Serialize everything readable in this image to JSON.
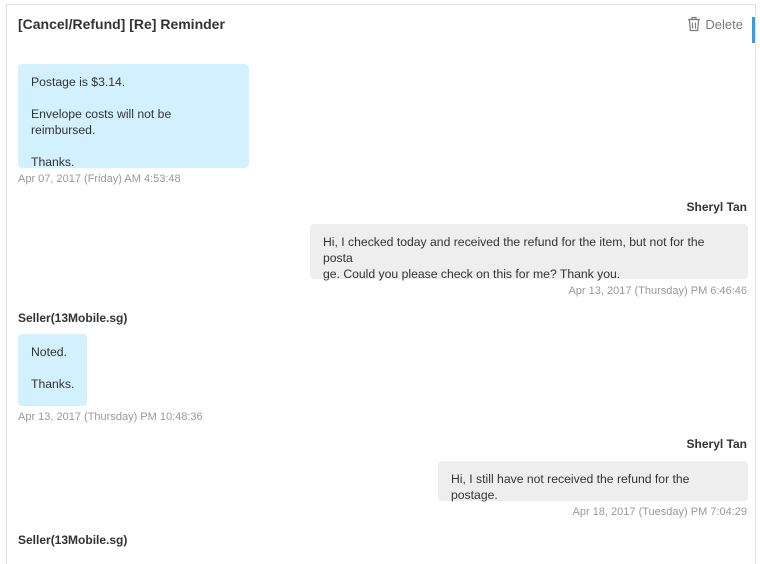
{
  "header": {
    "title": "[Cancel/Refund] [Re] Reminder",
    "delete_label": "Delete",
    "accent_color": "#2ea3e3"
  },
  "messages": [
    {
      "role": "seller",
      "sender": "",
      "lines": [
        "Postage is $3.14.",
        "Envelope costs will not be reimbursed.",
        "Thanks."
      ],
      "timestamp": "Apr 07, 2017 (Friday) AM 4:53:48"
    },
    {
      "role": "buyer",
      "sender": "Sheryl Tan",
      "text": "Hi, I checked today and received the refund for the item, but not for the postage. Could you please check on this for me? Thank you.",
      "line1": "Hi, I checked today and received the refund for the item, but not for the posta",
      "line2": "ge. Could you please check on this for me? Thank you.",
      "timestamp": "Apr 13, 2017 (Thursday) PM 6:46:46"
    },
    {
      "role": "seller",
      "sender": "Seller(13Mobile.sg)",
      "lines": [
        "Noted.",
        "Thanks."
      ],
      "timestamp": "Apr 13, 2017 (Thursday) PM 10:48:36"
    },
    {
      "role": "buyer",
      "sender": "Sheryl Tan",
      "text": "Hi, I still have not received the refund for the postage.",
      "timestamp": "Apr 18, 2017 (Tuesday) PM 7:04:29"
    },
    {
      "role": "seller",
      "sender": "Seller(13Mobile.sg)"
    }
  ],
  "colors": {
    "seller_bubble": "#d2f0fd",
    "buyer_bubble": "#eeeeee",
    "timestamp": "#999999"
  },
  "icons": {
    "delete": "trash-icon"
  }
}
